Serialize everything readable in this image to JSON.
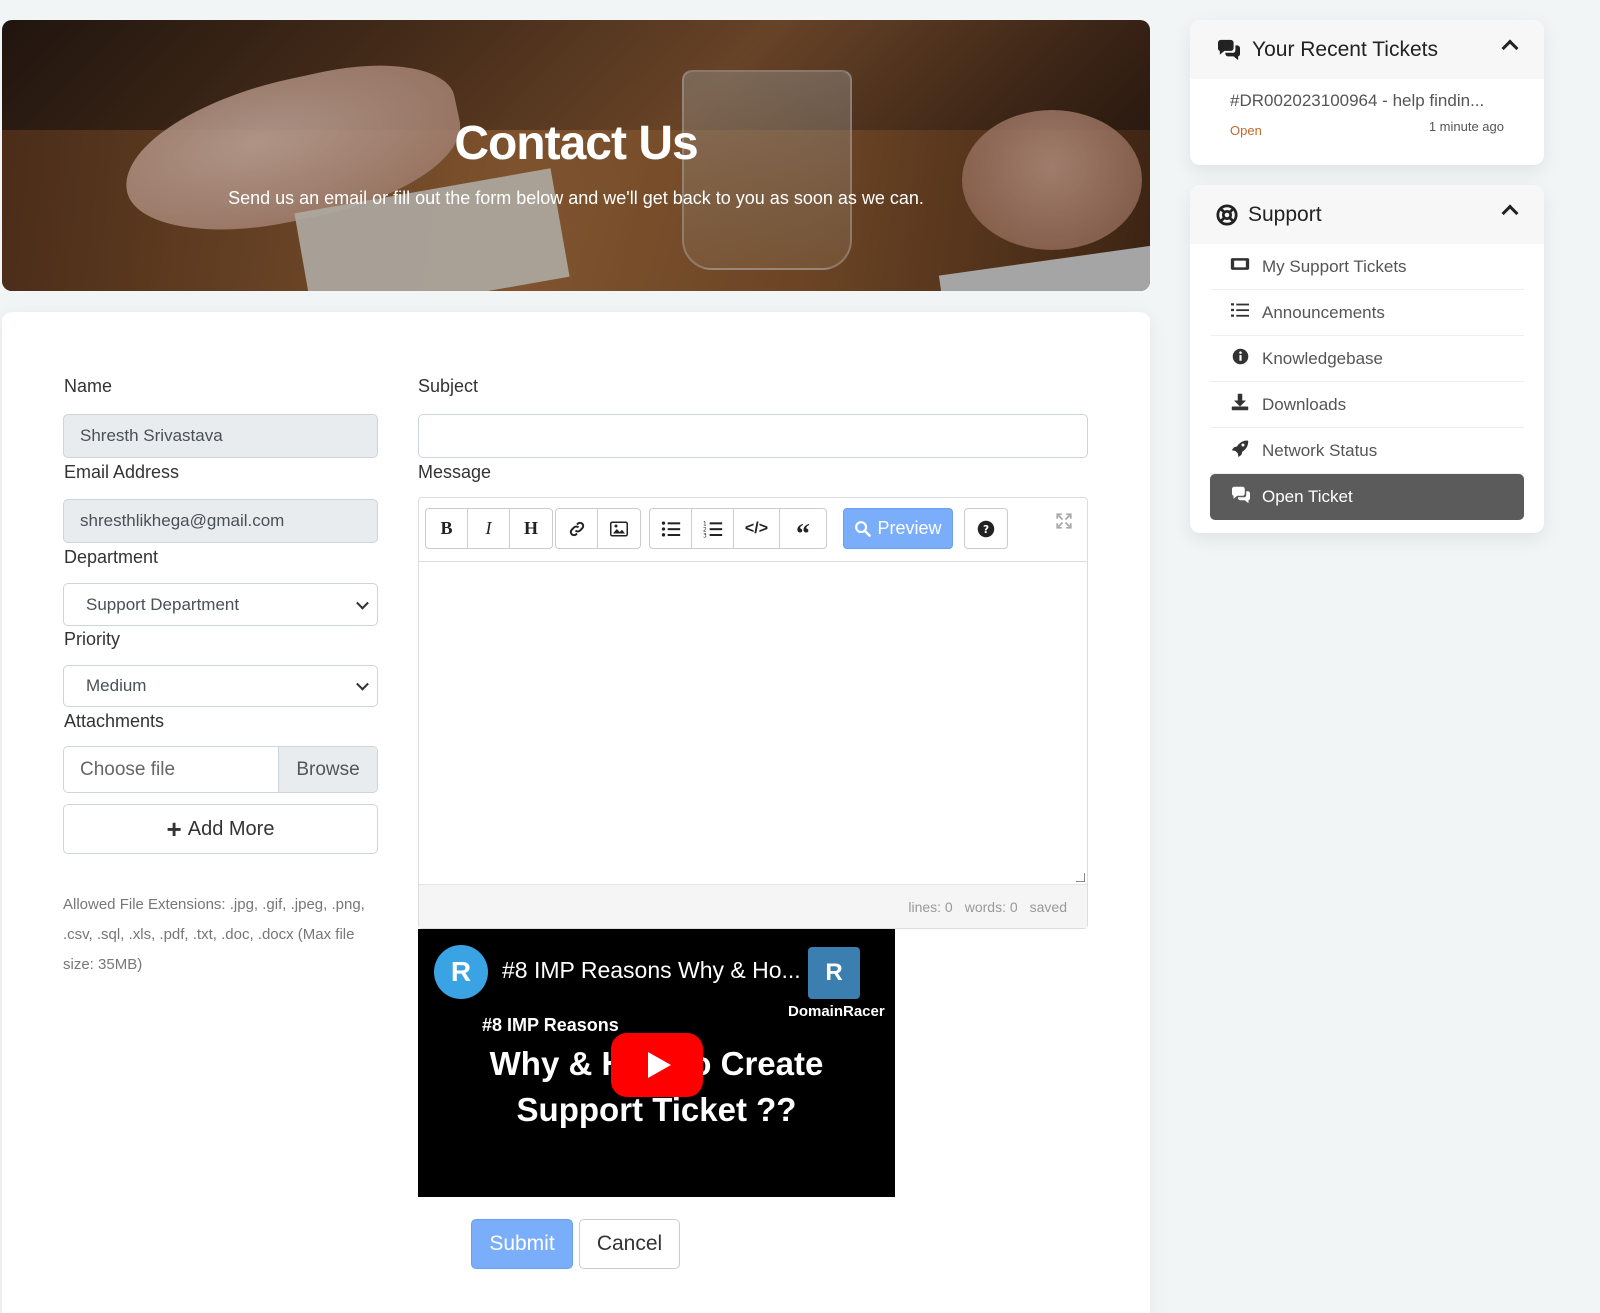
{
  "hero": {
    "title": "Contact Us",
    "subtitle": "Send us an email or fill out the form below and we'll get back to you as soon as we can."
  },
  "form": {
    "name_label": "Name",
    "name_value": "Shresth Srivastava",
    "email_label": "Email Address",
    "email_value": "shresthlikhega@gmail.com",
    "department_label": "Department",
    "department_value": "Support Department",
    "priority_label": "Priority",
    "priority_value": "Medium",
    "attachments_label": "Attachments",
    "choose_file": "Choose file",
    "browse": "Browse",
    "add_more": "Add More",
    "allowed_extensions": "Allowed File Extensions: .jpg, .gif, .jpeg, .png, .csv, .sql, .xls, .pdf, .txt, .doc, .docx (Max file size: 35MB)",
    "subject_label": "Subject",
    "subject_value": "",
    "message_label": "Message",
    "submit": "Submit",
    "cancel": "Cancel"
  },
  "editor": {
    "toolbar": {
      "bold": "B",
      "italic": "I",
      "heading": "H",
      "preview": "Preview"
    },
    "status": {
      "lines": "lines: 0",
      "words": "words: 0",
      "saved": "saved"
    }
  },
  "video": {
    "title": "#8 IMP Reasons Why & Ho...",
    "brand": "DomainRacer",
    "subtitle": "#8 IMP Reasons",
    "line1": "Why & How to Create",
    "line2": "Support Ticket ??"
  },
  "sidebar": {
    "recent": {
      "title": "Your Recent Tickets",
      "tickets": [
        {
          "title": "#DR002023100964 - help findin...",
          "status": "Open",
          "time": "1 minute ago"
        }
      ]
    },
    "support": {
      "title": "Support",
      "items": [
        {
          "label": "My Support Tickets",
          "icon": "ticket-icon"
        },
        {
          "label": "Announcements",
          "icon": "list-icon"
        },
        {
          "label": "Knowledgebase",
          "icon": "info-icon"
        },
        {
          "label": "Downloads",
          "icon": "download-icon"
        },
        {
          "label": "Network Status",
          "icon": "rocket-icon"
        },
        {
          "label": "Open Ticket",
          "icon": "comments-icon",
          "active": true
        }
      ]
    }
  },
  "colors": {
    "primary": "#7aaefb",
    "active_menu": "#5b5b5b",
    "status_open": "#c36a2d"
  }
}
